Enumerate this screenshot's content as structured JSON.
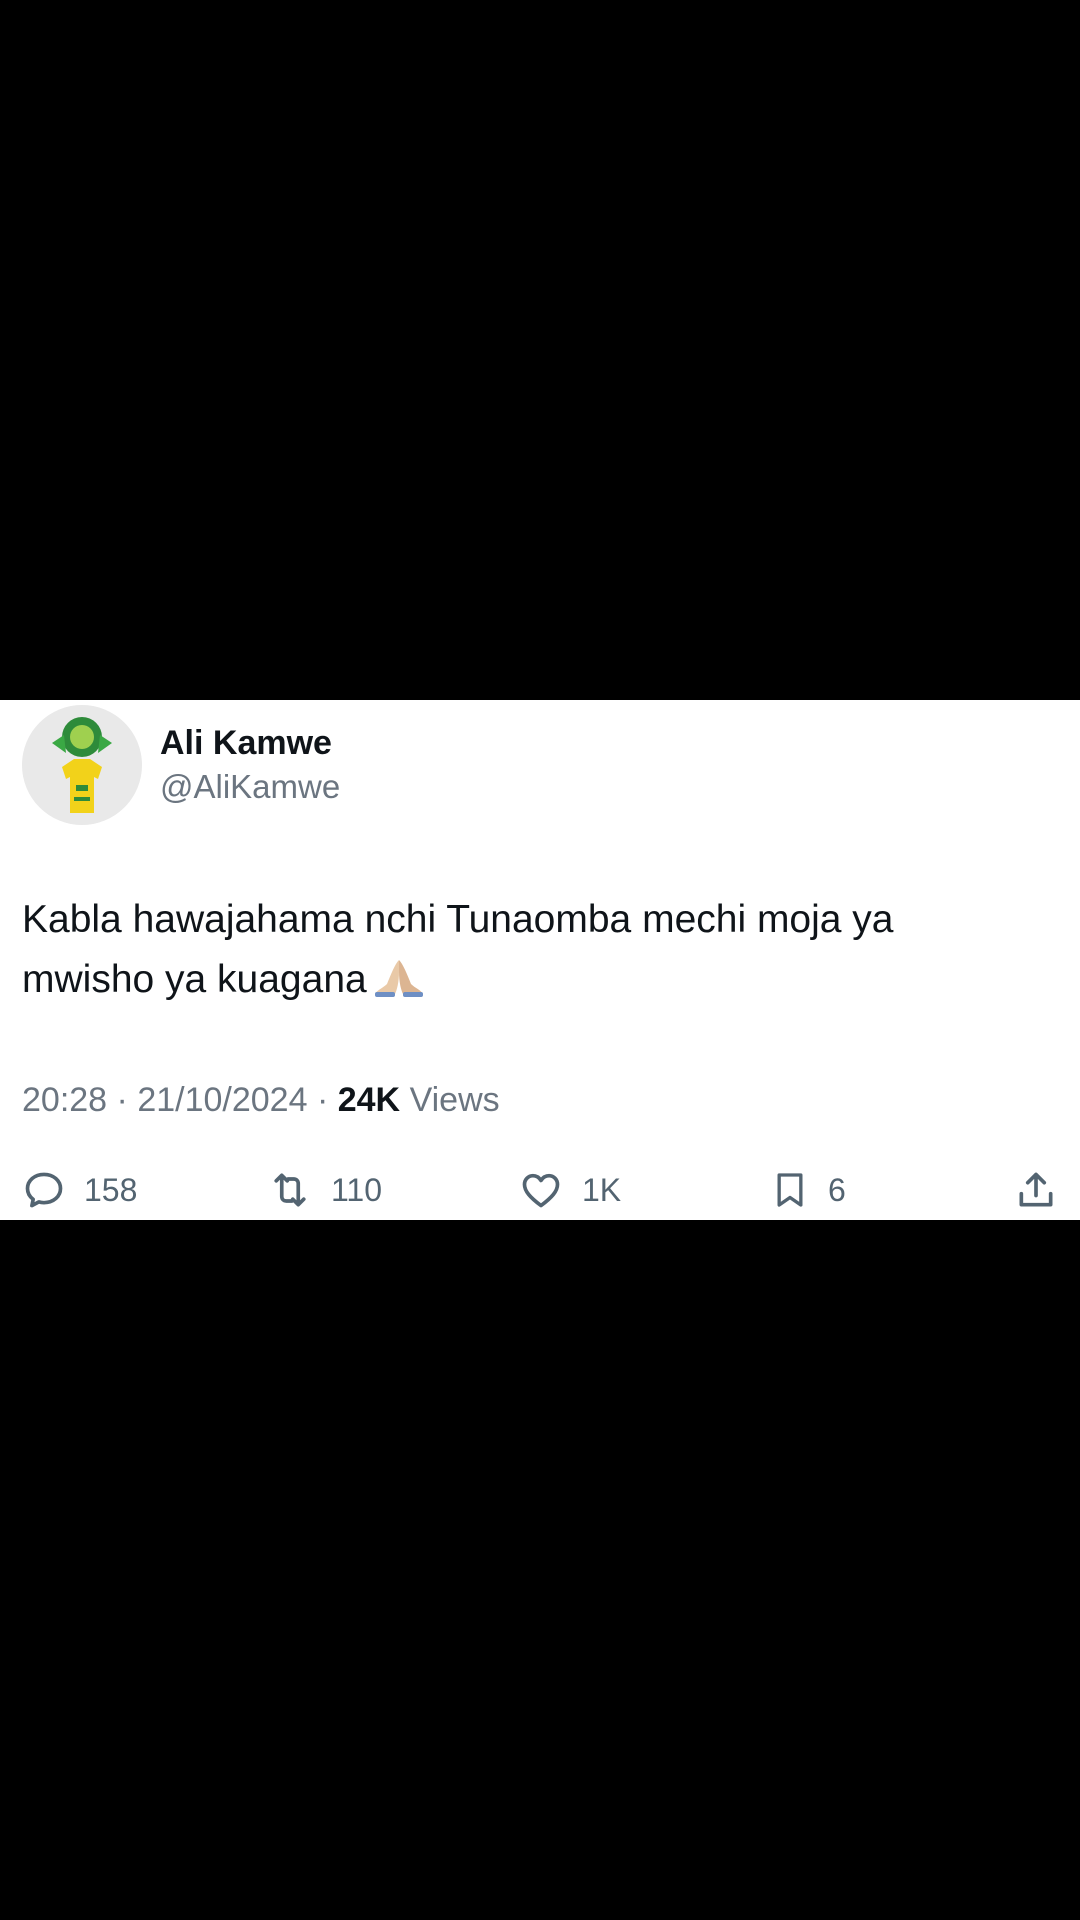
{
  "tweet": {
    "author": {
      "display_name": "Ali Kamwe",
      "handle": "@AliKamwe",
      "avatar_icon": "club-badge-avatar"
    },
    "text_line_1": "Kabla hawajahama nchi Tunaomba mechi moja ya",
    "text_line_2": "mwisho ya kuagana",
    "emoji": "folded-hands-emoji",
    "time": "20:28",
    "separator": "·",
    "date": "21/10/2024",
    "views_count": "24K",
    "views_label": "Views",
    "stats": {
      "replies": "158",
      "retweets": "110",
      "likes": "1K",
      "bookmarks": "6"
    }
  },
  "colors": {
    "background": "#000000",
    "card": "#ffffff",
    "text": "#0f1419",
    "secondary": "#6b7580",
    "icon": "#536471"
  }
}
